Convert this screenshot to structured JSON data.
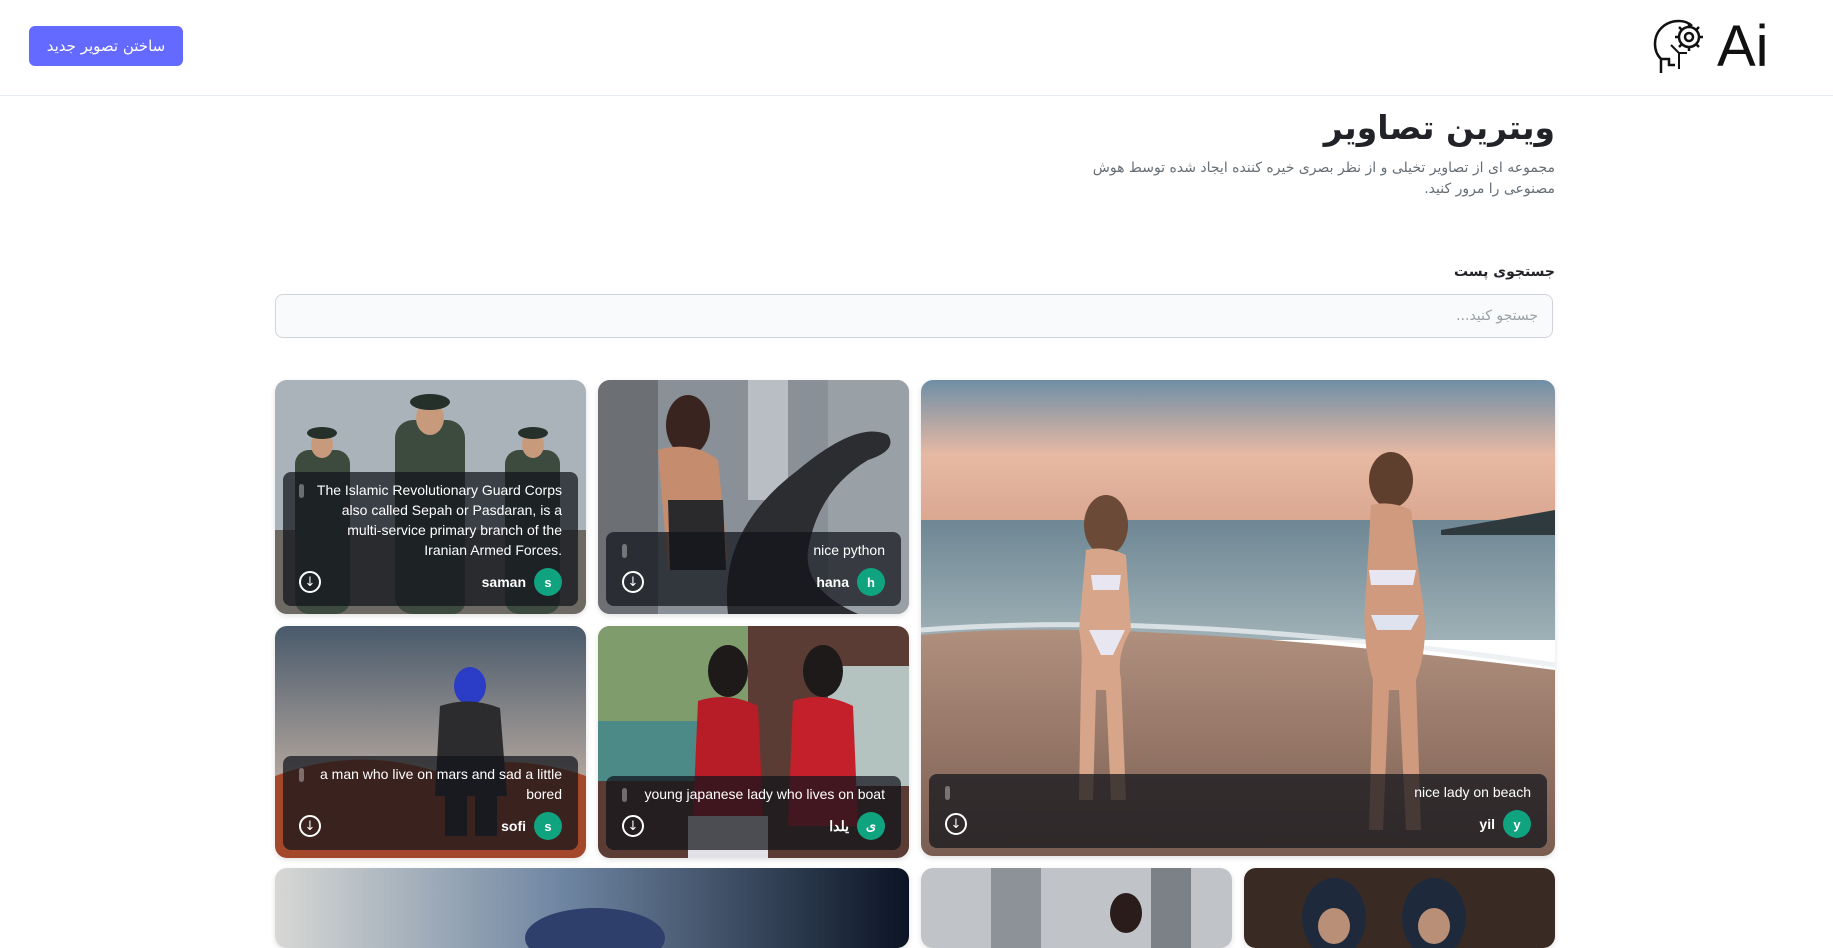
{
  "header": {
    "logo_text": "Ai",
    "logo_icon": "ai-head-gear-icon",
    "create_button": "ساختن تصویر جدید"
  },
  "hero": {
    "title": "ویترین تصاویر",
    "subtitle": "مجموعه ای از تصاویر تخیلی و از نظر بصری خیره کننده ایجاد شده توسط هوش مصنوعی را مرور کنید."
  },
  "search": {
    "label": "جستجوی پست",
    "placeholder": "جستجو کنید...",
    "value": ""
  },
  "posts": [
    {
      "prompt": "nice lady on beach",
      "author": "yil",
      "initial": "y",
      "scene": "beach at sunset with two women in bikinis"
    },
    {
      "prompt": "nice python",
      "author": "hana",
      "initial": "h",
      "scene": "woman with large black python in city"
    },
    {
      "prompt": "The Islamic Revolutionary Guard Corps also called Sepah or Pasdaran, is a multi-service primary branch of the Iranian Armed Forces.",
      "author": "saman",
      "initial": "s",
      "scene": "soldiers in green uniforms and caps"
    },
    {
      "prompt": "young japanese lady who lives on boat",
      "author": "یلدا",
      "initial": "ی",
      "scene": "two women in red sweaters on a boat by a lake"
    },
    {
      "prompt": "a man who live on mars and sad a little bored",
      "author": "sofi",
      "initial": "s",
      "scene": "astronaut in armor on red martian desert"
    }
  ],
  "colors": {
    "accent": "#6469ff",
    "avatar": "#10a37f",
    "title": "#222328",
    "subtitle": "#666e75"
  },
  "icons": {
    "download": "download-circle-icon"
  }
}
